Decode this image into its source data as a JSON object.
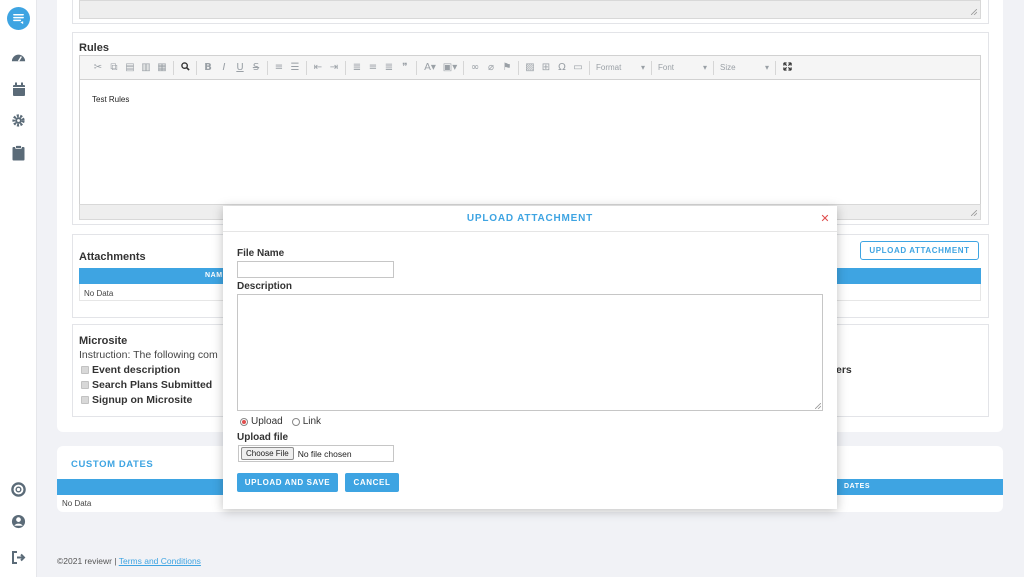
{
  "rules": {
    "heading": "Rules",
    "content": "Test Rules",
    "toolbar": {
      "format_label": "Format",
      "font_label": "Font",
      "size_label": "Size"
    }
  },
  "attachments": {
    "heading": "Attachments",
    "upload_button": "UPLOAD ATTACHMENT",
    "column_partial": "NAM",
    "empty_text": "No Data"
  },
  "microsite": {
    "heading": "Microsite",
    "instruction": "Instruction: The following com",
    "checks": [
      "Event description",
      "Search Plans Submitted",
      "Signup on Microsite"
    ],
    "right_partial": "ers"
  },
  "custom_dates": {
    "heading": "CUSTOM DATES",
    "column_partial": "DATES",
    "empty_text": "No Data"
  },
  "footer": {
    "copyright": "©2021 reviewr |",
    "terms_link": "Terms and Conditions"
  },
  "modal": {
    "title": "UPLOAD ATTACHMENT",
    "file_name_label": "File Name",
    "file_name_value": "",
    "description_label": "Description",
    "description_value": "",
    "radio_upload": "Upload",
    "radio_link": "Link",
    "selected_radio": "Upload",
    "upload_file_label": "Upload file",
    "choose_file_button": "Choose File",
    "no_file_text": "No file chosen",
    "save_button": "UPLOAD AND SAVE",
    "cancel_button": "CANCEL"
  },
  "colors": {
    "accent": "#3ea4e2",
    "close": "#e04e4e",
    "sidebar_icon": "#5b6b78"
  },
  "sidebar": {
    "icons": [
      "chat-logo-icon",
      "dashboard-icon",
      "calendar-icon",
      "gear-icon",
      "clipboard-icon",
      "help-icon",
      "user-icon",
      "logout-icon"
    ]
  }
}
